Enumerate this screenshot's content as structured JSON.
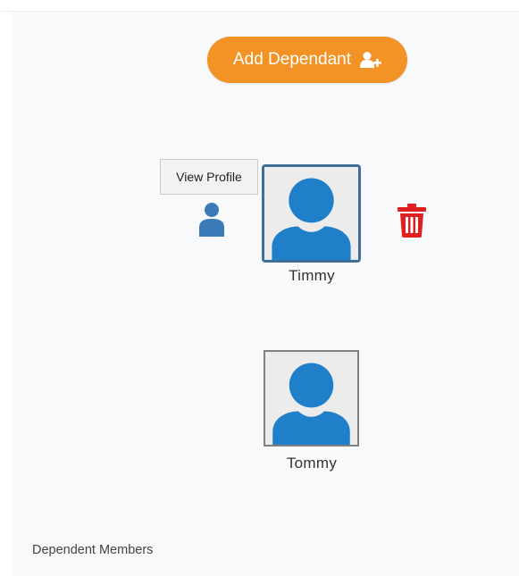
{
  "header": {
    "add_button_label": "Add Dependant",
    "add_button_icon": "user-plus-icon"
  },
  "tooltip": {
    "text": "View Profile"
  },
  "dependants": [
    {
      "name": "Timmy",
      "selected": true
    },
    {
      "name": "Tommy",
      "selected": false
    }
  ],
  "actions": {
    "view_profile_icon": "user-icon",
    "delete_icon": "trash-icon"
  },
  "footer": {
    "section_title": "Dependent Members"
  },
  "colors": {
    "accent_orange": "#f39325",
    "avatar_blue": "#1f7fc9",
    "user_icon_blue": "#3a7ab8",
    "delete_red": "#e02020",
    "selected_border": "#3f6f97"
  }
}
